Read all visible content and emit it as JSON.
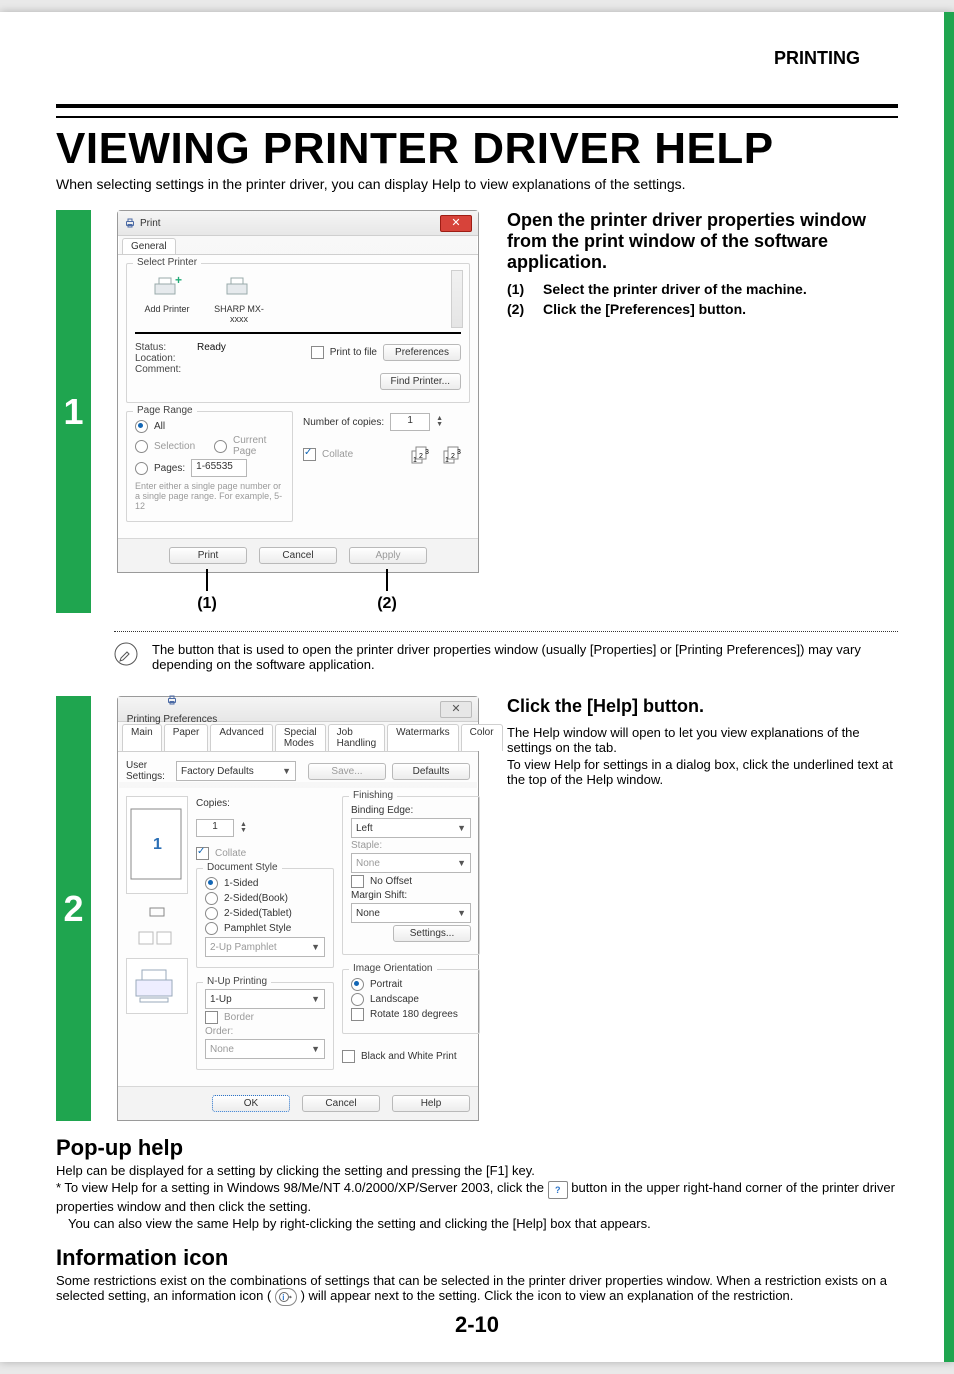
{
  "header": {
    "section": "PRINTING"
  },
  "title": "VIEWING PRINTER DRIVER HELP",
  "subtitle": "When selecting settings in the printer driver, you can display Help to view explanations of the settings.",
  "step1": {
    "num": "1",
    "heading": "Open the printer driver properties window from the print window of the software application.",
    "items": [
      {
        "n": "(1)",
        "text": "Select the printer driver of the machine."
      },
      {
        "n": "(2)",
        "text": "Click the [Preferences] button."
      }
    ],
    "callouts": [
      "(1)",
      "(2)"
    ],
    "note": "The button that is used to open the printer driver properties window (usually [Properties] or [Printing Preferences]) may vary depending on the software application."
  },
  "print_window": {
    "title": "Print",
    "tab": "General",
    "select_printer_legend": "Select Printer",
    "printers": [
      {
        "name": "Add Printer"
      },
      {
        "name": "SHARP MX-xxxx"
      }
    ],
    "status_k": "Status:",
    "status_v": "Ready",
    "location_k": "Location:",
    "comment_k": "Comment:",
    "print_to_file": "Print to file",
    "preferences": "Preferences",
    "find_printer": "Find Printer...",
    "page_range_legend": "Page Range",
    "all": "All",
    "selection": "Selection",
    "current_page": "Current Page",
    "pages": "Pages:",
    "pages_value": "1-65535",
    "pages_help": "Enter either a single page number or a single page range.  For example, 5-12",
    "copies_k": "Number of copies:",
    "copies_v": "1",
    "collate": "Collate",
    "footer": {
      "print": "Print",
      "cancel": "Cancel",
      "apply": "Apply"
    }
  },
  "step2": {
    "num": "2",
    "heading": "Click the [Help] button.",
    "para1": "The Help window will open to let you view explanations of the settings on the tab.",
    "para2": "To view Help for settings in a dialog box, click the underlined text at the top of the Help window."
  },
  "pref_window": {
    "title": "Printing Preferences",
    "tabs": [
      "Main",
      "Paper",
      "Advanced",
      "Special Modes",
      "Job Handling",
      "Watermarks",
      "Color"
    ],
    "user_settings_k": "User Settings:",
    "user_settings_v": "Factory Defaults",
    "save": "Save...",
    "defaults": "Defaults",
    "left_num": "1",
    "copies_k": "Copies:",
    "copies_v": "1",
    "collate": "Collate",
    "doc_style_legend": "Document Style",
    "ds_1sided": "1-Sided",
    "ds_2book": "2-Sided(Book)",
    "ds_2tablet": "2-Sided(Tablet)",
    "ds_pamphlet": "Pamphlet Style",
    "ds_pamphlet_v": "2-Up Pamphlet",
    "nup_legend": "N-Up Printing",
    "nup_v": "1-Up",
    "border": "Border",
    "order_k": "Order:",
    "order_v": "None",
    "finishing_legend": "Finishing",
    "binding_k": "Binding Edge:",
    "binding_v": "Left",
    "staple_k": "Staple:",
    "staple_v": "None",
    "no_offset": "No Offset",
    "margin_k": "Margin Shift:",
    "margin_v": "None",
    "settings": "Settings...",
    "orient_legend": "Image Orientation",
    "orient_portrait": "Portrait",
    "orient_landscape": "Landscape",
    "rotate180": "Rotate 180 degrees",
    "bw": "Black and White Print",
    "footer": {
      "ok": "OK",
      "cancel": "Cancel",
      "help": "Help"
    }
  },
  "popup": {
    "heading": "Pop-up help",
    "line1": "Help can be displayed for a setting by clicking the setting and pressing the [F1] key.",
    "line2a": "* To view Help for a setting in Windows 98/Me/NT 4.0/2000/XP/Server 2003, click the ",
    "line2b": " button in the upper right-hand corner of the printer driver properties window and then click the setting.",
    "line3": "You can also view the same Help by right-clicking the setting and clicking the [Help] box that appears."
  },
  "infoicon": {
    "heading": "Information icon",
    "line_a": "Some restrictions exist on the combinations of settings that can be selected in the printer driver properties window. When a restriction exists on a selected setting, an information icon ( ",
    "line_b": " ) will appear next to the setting. Click the icon to view an explanation of the restriction."
  },
  "page_number": "2-10"
}
